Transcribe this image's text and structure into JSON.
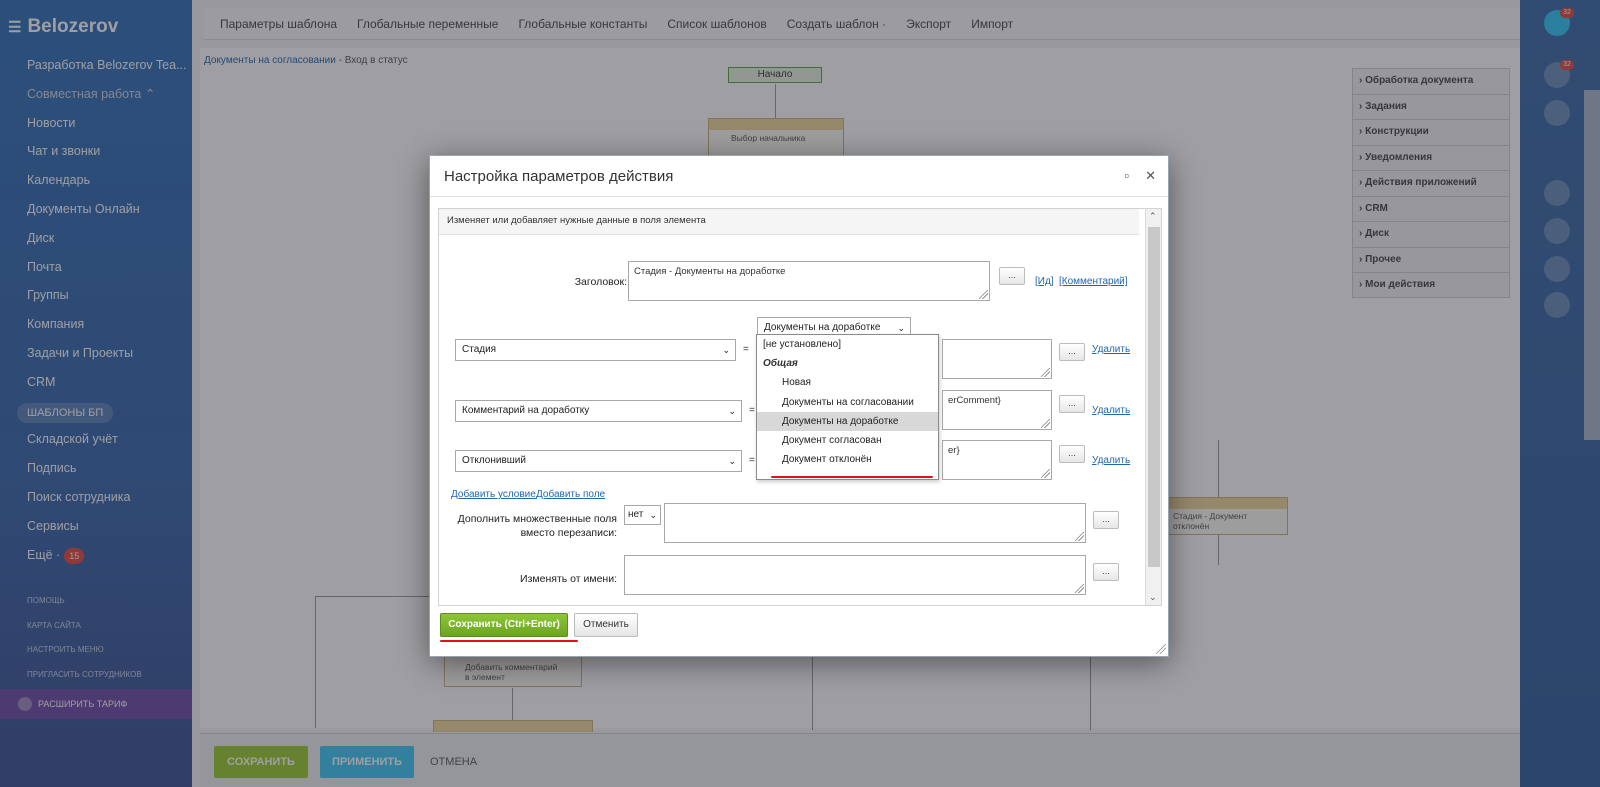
{
  "sidebar": {
    "logo": "Belozerov",
    "items": [
      {
        "label": "Разработка Belozerov Tea..."
      },
      {
        "label": "Совместная работа ⌃",
        "group": true
      },
      {
        "label": "Новости"
      },
      {
        "label": "Чат и звонки"
      },
      {
        "label": "Календарь"
      },
      {
        "label": "Документы Онлайн"
      },
      {
        "label": "Диск"
      },
      {
        "label": "Почта"
      },
      {
        "label": "Группы"
      },
      {
        "label": "Компания"
      },
      {
        "label": "Задачи и Проекты"
      },
      {
        "label": "CRM"
      },
      {
        "label": "ШАБЛОНЫ БП",
        "active": true
      },
      {
        "label": "Складской учёт"
      },
      {
        "label": "Подпись"
      },
      {
        "label": "Поиск сотрудника"
      },
      {
        "label": "Сервисы"
      },
      {
        "label": "Ещё ·",
        "badge": "15"
      }
    ],
    "footer": [
      "ПОМОЩЬ",
      "КАРТА САЙТА",
      "НАСТРОИТЬ МЕНЮ",
      "ПРИГЛАСИТЬ СОТРУДНИКОВ"
    ],
    "tariff": "РАСШИРИТЬ ТАРИФ"
  },
  "toolbar": {
    "items": [
      "Параметры шаблона",
      "Глобальные переменные",
      "Глобальные константы",
      "Список шаблонов",
      "Создать шаблон ·",
      "Экспорт",
      "Импорт"
    ]
  },
  "breadcrumb": {
    "link": "Документы на согласовании",
    "current": " - Вход в статус"
  },
  "canvas": {
    "start": "Начало",
    "node1": "Выбор начальника",
    "node2": "Стадия - Документ отклонён",
    "node3": "Добавить комментарий в элемент"
  },
  "right_panel": [
    "Обработка документа",
    "Задания",
    "Конструкции",
    "Уведомления",
    "Действия приложений",
    "CRM",
    "Диск",
    "Прочее",
    "Мои действия"
  ],
  "right_strip": {
    "badge1": "32",
    "badge2": "32"
  },
  "bottom_bar": {
    "save": "СОХРАНИТЬ",
    "apply": "ПРИМЕНИТЬ",
    "cancel": "ОТМЕНА"
  },
  "dialog": {
    "title": "Настройка параметров действия",
    "description": "Изменяет или добавляет нужные данные в поля элемента",
    "title_label": "Заголовок:",
    "title_value": "Стадия - Документы на доработке",
    "dots": "...",
    "link_id": "[Ид]",
    "link_comment": "[Комментарий]",
    "rows": [
      {
        "field": "Стадия",
        "value": "",
        "delete": "Удалить"
      },
      {
        "field": "Комментарий на доработку",
        "value": "erComment}",
        "delete": "Удалить"
      },
      {
        "field": "Отклонивший",
        "value": "er}",
        "delete": "Удалить"
      }
    ],
    "eq": "=",
    "stage_selected": "Документы на доработке",
    "dropdown": {
      "top": "[не установлено]",
      "group": "Общая",
      "options": [
        "Новая",
        "Документы на согласовании",
        "Документы на доработке",
        "Документ согласован",
        "Документ отклонён"
      ],
      "highlighted": "Документы на доработке"
    },
    "add_condition": "Добавить условие",
    "add_field": "Добавить поле",
    "append_label_1": "Дополнить множественные поля",
    "append_label_2": "вместо перезаписи:",
    "append_value": "нет",
    "modify_as_label": "Изменять от имени:",
    "save": "Сохранить (Ctrl+Enter)",
    "cancel": "Отменить"
  }
}
